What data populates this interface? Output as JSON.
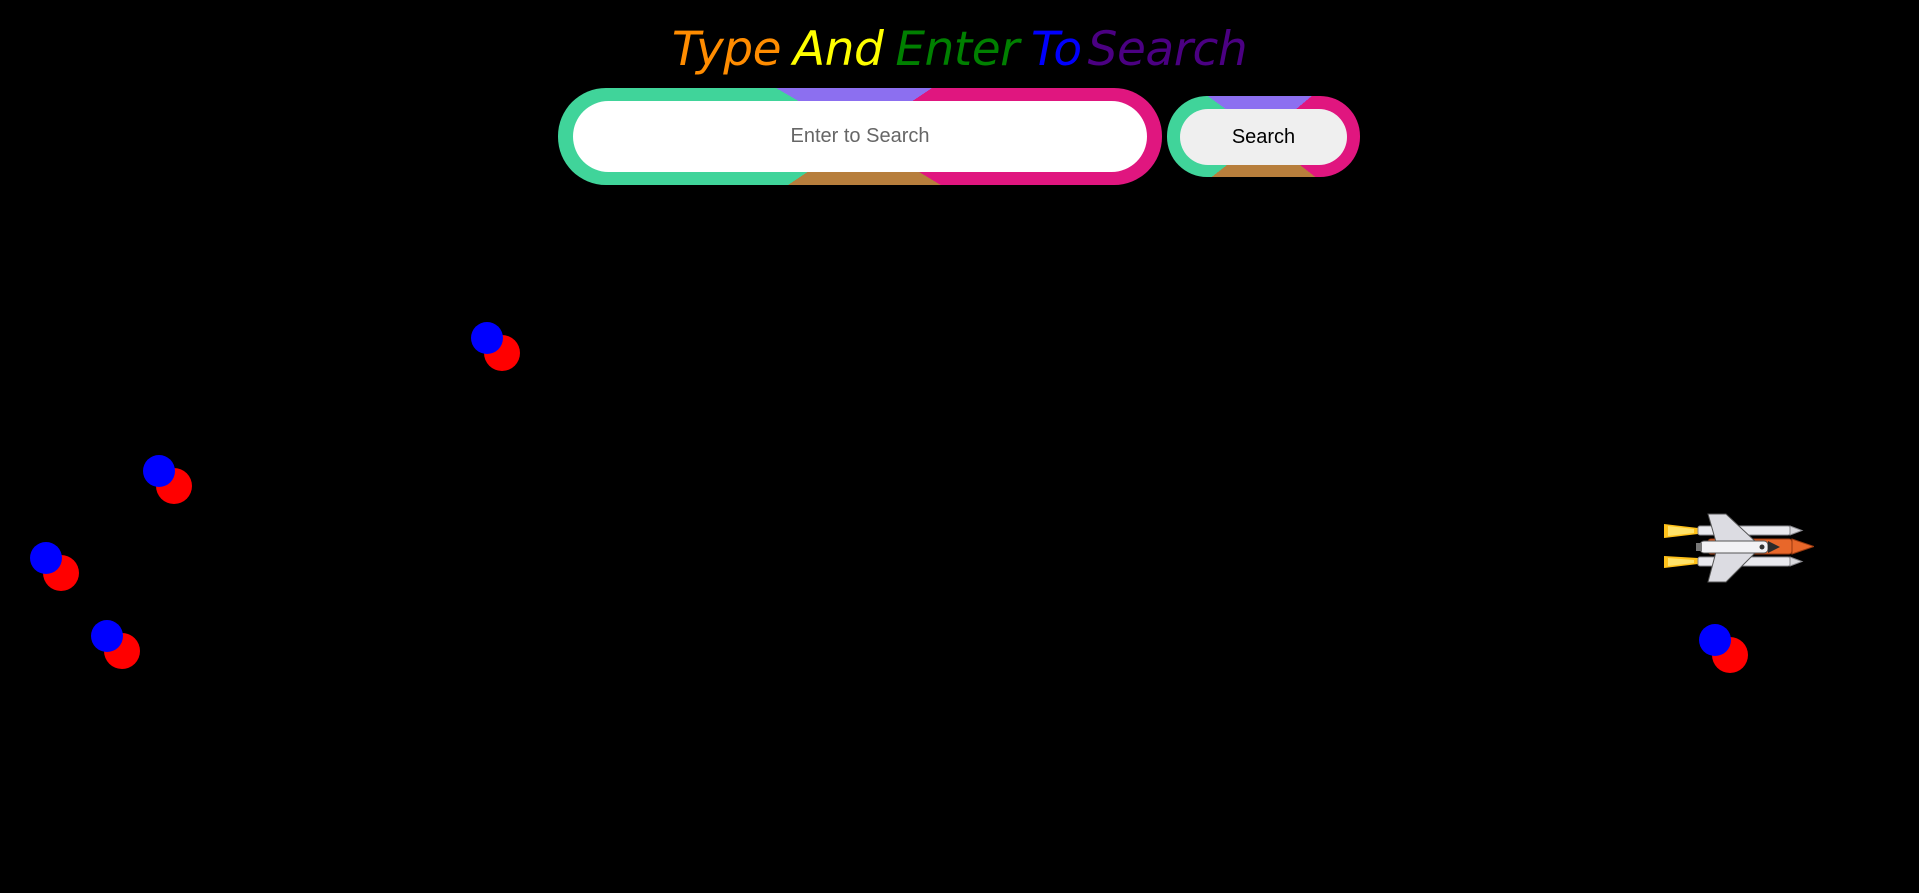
{
  "title": {
    "words": [
      "Type",
      "And",
      "Enter",
      "To",
      "Search"
    ],
    "colors": [
      "#ff8c00",
      "#ffff00",
      "#008000",
      "#0000ff",
      "#4b0082"
    ]
  },
  "search": {
    "placeholder": "Enter to Search",
    "value": ""
  },
  "button": {
    "label": "Search"
  },
  "border_colors": {
    "top": "#8c6ff0",
    "right": "#e0167f",
    "bottom": "#b77e3c",
    "left": "#40d49a"
  },
  "ball_colors": {
    "front": "#0000ff",
    "back": "#ff0000"
  },
  "background": "#000000",
  "sprite": {
    "icon": "space-shuttle-icon"
  }
}
